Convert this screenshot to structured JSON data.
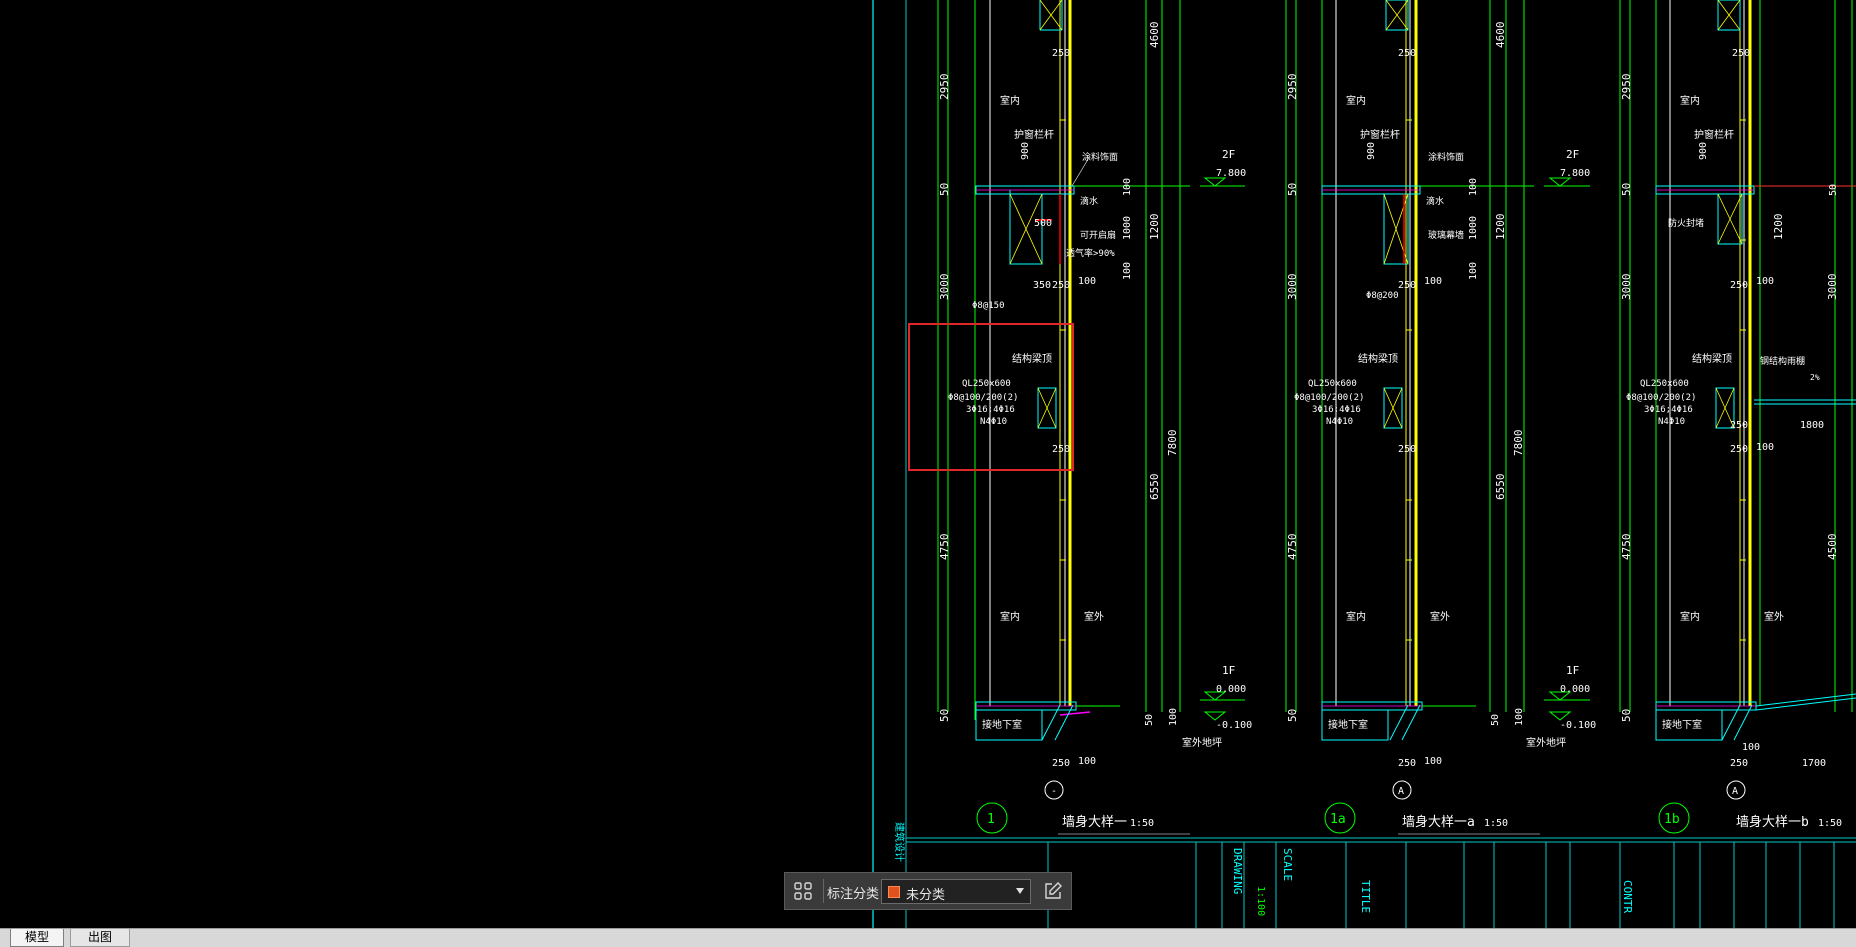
{
  "layout_tabs": [
    {
      "label": "模型",
      "active": true
    },
    {
      "label": "出图",
      "active": false
    }
  ],
  "annotation_toolbar": {
    "category_label": "标注分类",
    "selected_category": "未分类",
    "swatch_color": "#e0521c",
    "icons": {
      "left": "grid-icon",
      "right": "edit-icon"
    }
  },
  "drawing": {
    "details": [
      {
        "number": "1",
        "title": "墙身大样一",
        "scale": "1:50",
        "axis": "-"
      },
      {
        "number": "1a",
        "title": "墙身大样一a",
        "scale": "1:50",
        "axis": "A"
      },
      {
        "number": "1b",
        "title": "墙身大样一b",
        "scale": "1:50",
        "axis": "A"
      }
    ],
    "levels": {
      "f2": "2F",
      "f2_elev": "7.800",
      "f1": "1F",
      "f1_elev": "0.000",
      "ground": "-0.100",
      "ground_label": "室外地坪"
    },
    "room_labels": {
      "indoor": "室内",
      "outdoor": "室外",
      "basement": "接地下室",
      "railing": "护窗栏杆",
      "structural_beam": "结构梁顶"
    },
    "beam_text": [
      "QL250x600",
      "Φ8@100/200(2)",
      "3Φ16;4Φ16",
      "N4Φ10"
    ],
    "dims_left": [
      "2950",
      "50",
      "3000",
      "4750",
      "50"
    ],
    "dims_right": [
      "4600",
      "1200",
      "7800",
      "6550",
      "100",
      "50"
    ],
    "small_dims": [
      "250",
      "100",
      "350",
      "500",
      "900",
      "250"
    ],
    "title_block": {
      "drawing": "DRAWING",
      "scale": "SCALE",
      "scale_value": "1:100",
      "title": "TITLE",
      "contract": "CONTR"
    }
  }
}
